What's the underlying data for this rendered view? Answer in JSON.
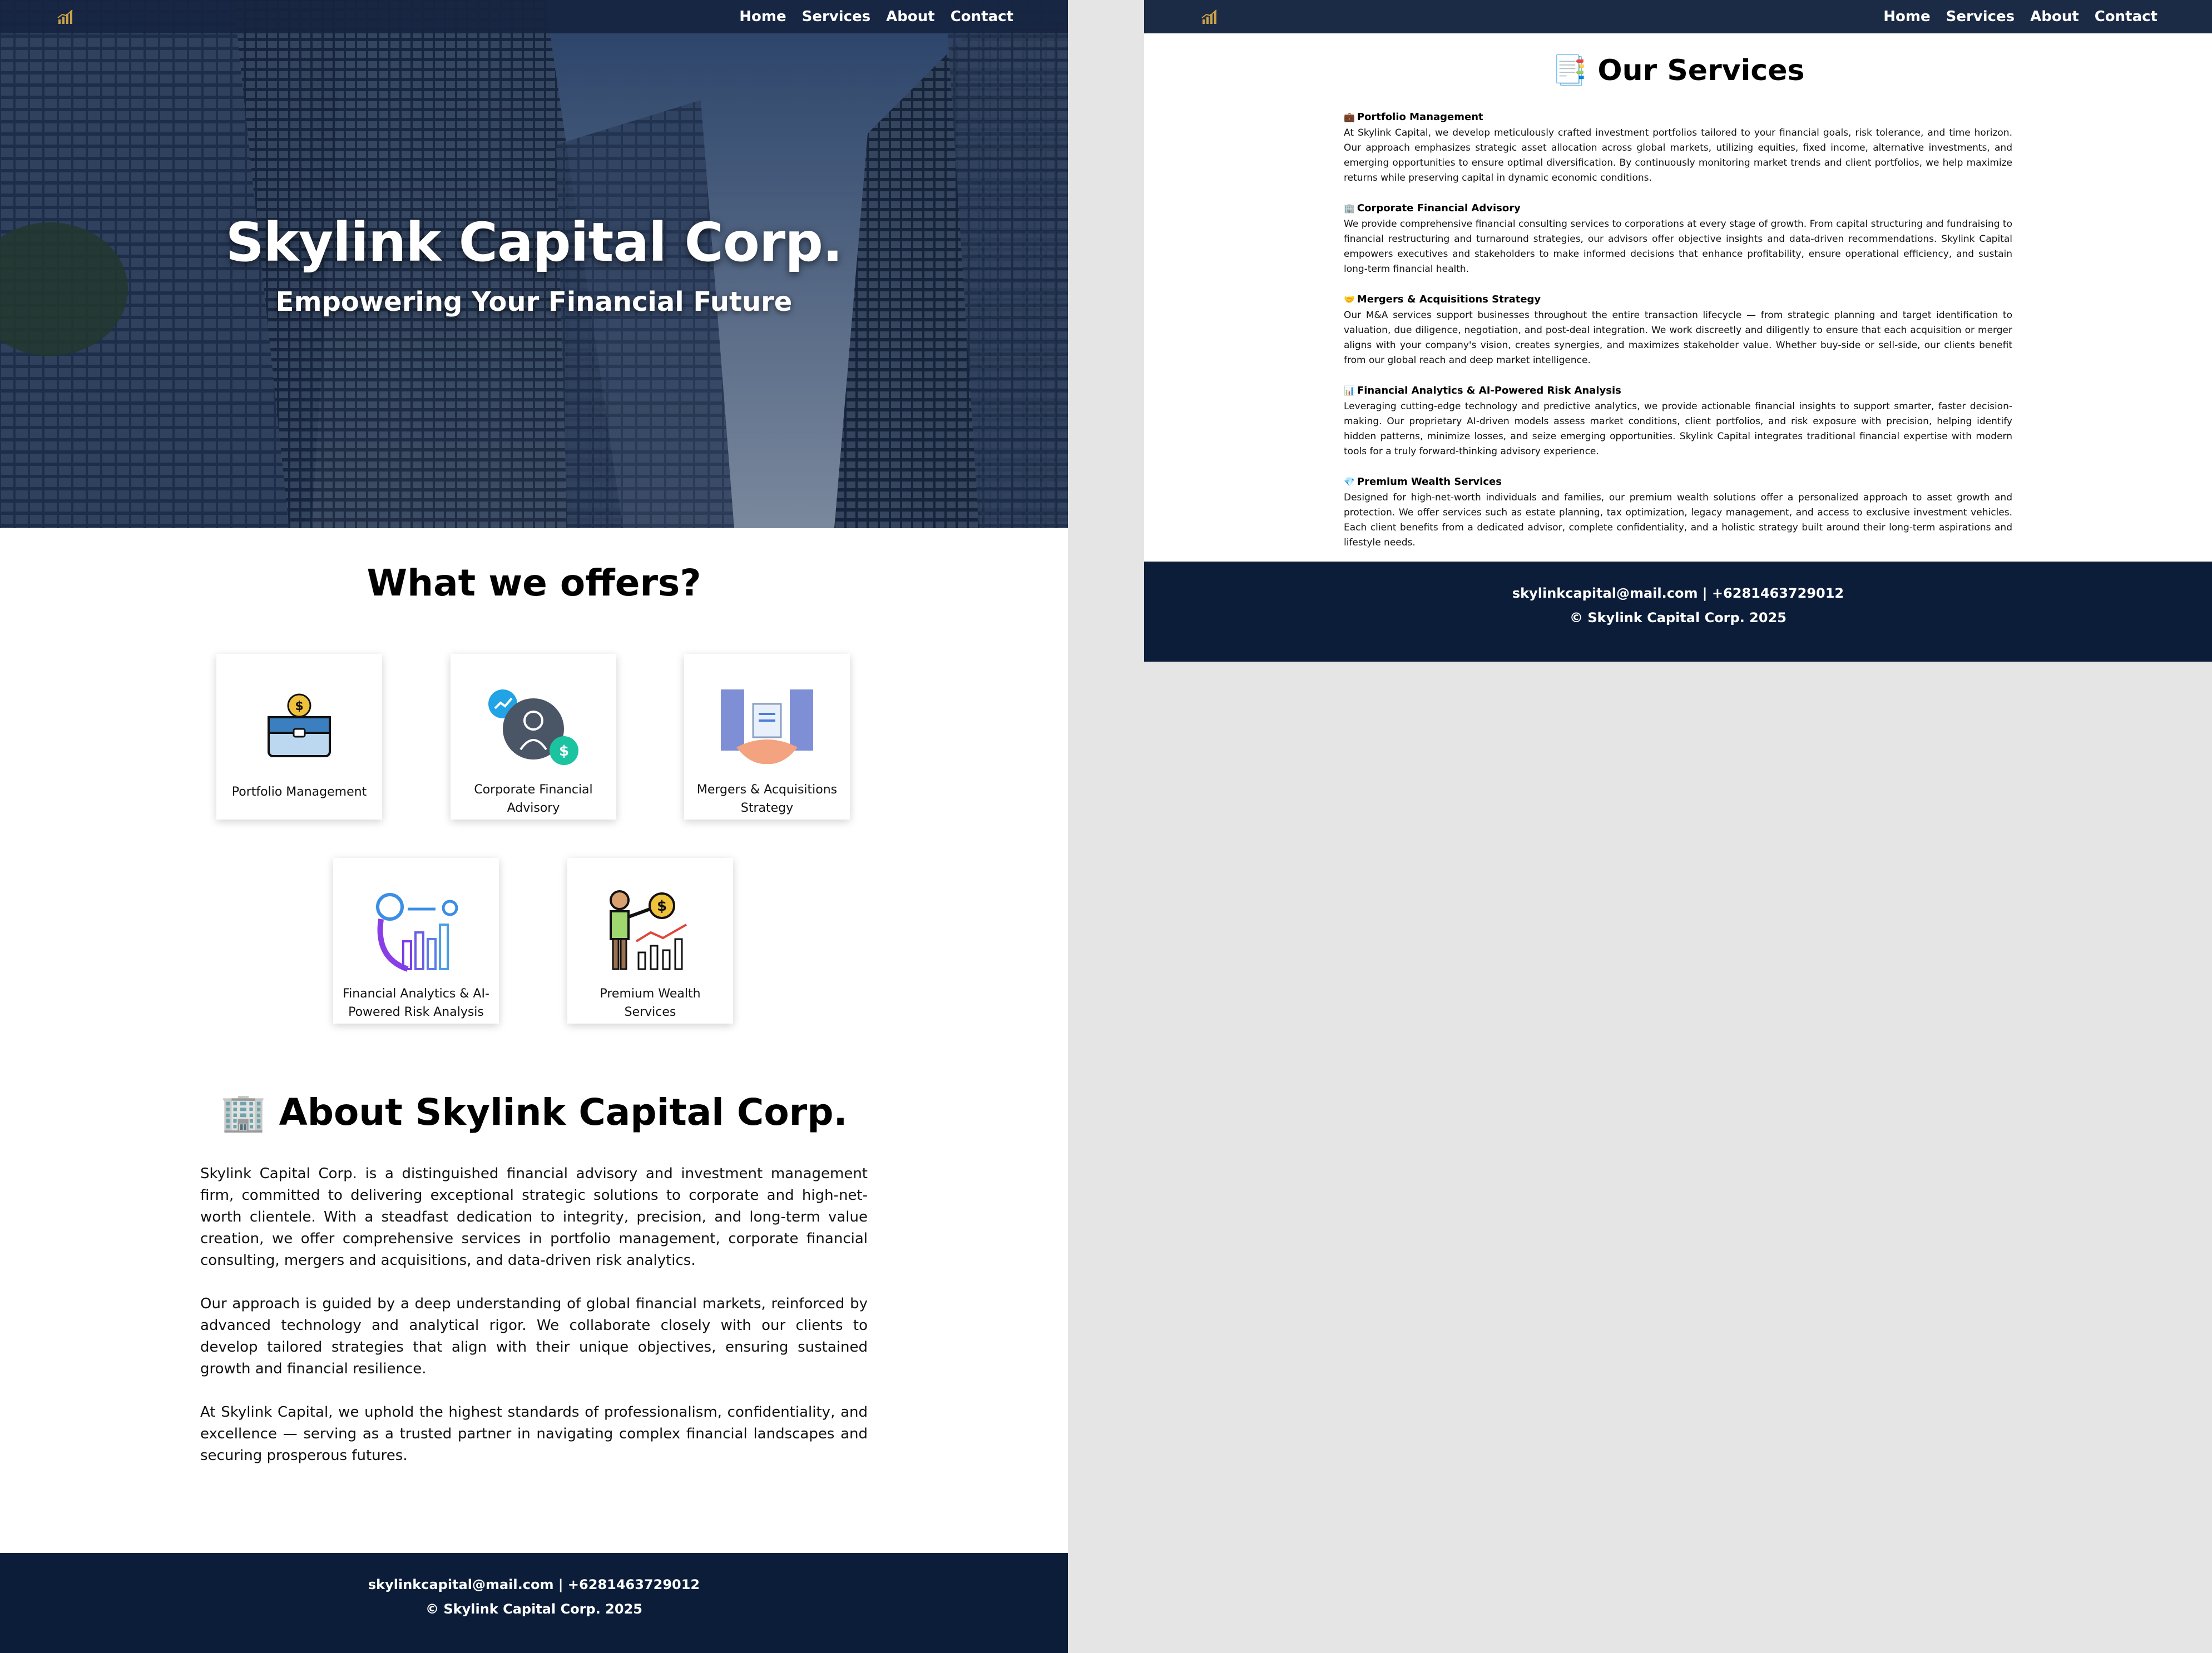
{
  "nav": {
    "items": [
      "Home",
      "Services",
      "About",
      "Contact"
    ]
  },
  "hero": {
    "title": "Skylink Capital Corp.",
    "subtitle": "Empowering Your Financial Future"
  },
  "offers": {
    "title": "What we offers?",
    "cards": [
      {
        "label": "Portfolio Management",
        "icon": "briefcase-coin-icon"
      },
      {
        "label": "Corporate Financial Advisory",
        "icon": "advisor-person-icon"
      },
      {
        "label": "Mergers & Acquisitions Strategy",
        "icon": "handshake-buildings-icon"
      },
      {
        "label": "Financial Analytics & AI-Powered Risk Analysis",
        "icon": "analytics-gear-chart-icon"
      },
      {
        "label": "Premium Wealth Services",
        "icon": "person-coin-chart-icon"
      }
    ]
  },
  "about": {
    "emoji": "🏢",
    "title": "About Skylink Capital Corp.",
    "paragraphs": [
      "Skylink Capital Corp. is a distinguished financial advisory and investment management firm, committed to delivering exceptional strategic solutions to corporate and high-net-worth clientele. With a steadfast dedication to integrity, precision, and long-term value creation, we offer comprehensive services in portfolio management, corporate financial consulting, mergers and acquisitions, and data-driven risk analytics.",
      "Our approach is guided by a deep understanding of global financial markets, reinforced by advanced technology and analytical rigor. We collaborate closely with our clients to develop tailored strategies that align with their unique objectives, ensuring sustained growth and financial resilience.",
      "At Skylink Capital, we uphold the highest standards of professionalism, confidentiality, and excellence — serving as a trusted partner in navigating complex financial landscapes and securing prosperous futures."
    ]
  },
  "footer": {
    "contact": "skylinkcapital@mail.com | +6281463729012",
    "copyright": "© Skylink Capital Corp. 2025"
  },
  "services": {
    "emoji": "📑",
    "title": "Our Services",
    "items": [
      {
        "emoji": "💼",
        "heading": "Portfolio Management",
        "body": "At Skylink Capital, we develop meticulously crafted investment portfolios tailored to your financial goals, risk tolerance, and time horizon. Our approach emphasizes strategic asset allocation across global markets, utilizing equities, fixed income, alternative investments, and emerging opportunities to ensure optimal diversification. By continuously monitoring market trends and client portfolios, we help maximize returns while preserving capital in dynamic economic conditions."
      },
      {
        "emoji": "🏢",
        "heading": "Corporate Financial Advisory",
        "body": "We provide comprehensive financial consulting services to corporations at every stage of growth. From capital structuring and fundraising to financial restructuring and turnaround strategies, our advisors offer objective insights and data-driven recommendations. Skylink Capital empowers executives and stakeholders to make informed decisions that enhance profitability, ensure operational efficiency, and sustain long-term financial health."
      },
      {
        "emoji": "🤝",
        "heading": "Mergers & Acquisitions Strategy",
        "body": "Our M&A services support businesses throughout the entire transaction lifecycle — from strategic planning and target identification to valuation, due diligence, negotiation, and post-deal integration. We work discreetly and diligently to ensure that each acquisition or merger aligns with your company's vision, creates synergies, and maximizes stakeholder value. Whether buy-side or sell-side, our clients benefit from our global reach and deep market intelligence."
      },
      {
        "emoji": "📊",
        "heading": "Financial Analytics & AI-Powered Risk Analysis",
        "body": "Leveraging cutting-edge technology and predictive analytics, we provide actionable financial insights to support smarter, faster decision-making. Our proprietary AI-driven models assess market conditions, client portfolios, and risk exposure with precision, helping identify hidden patterns, minimize losses, and seize emerging opportunities. Skylink Capital integrates traditional financial expertise with modern tools for a truly forward-thinking advisory experience."
      },
      {
        "emoji": "💎",
        "heading": "Premium Wealth Services",
        "body": "Designed for high-net-worth individuals and families, our premium wealth solutions offer a personalized approach to asset growth and protection. We offer services such as estate planning, tax optimization, legacy management, and access to exclusive investment vehicles. Each client benefits from a dedicated advisor, complete confidentiality, and a holistic strategy built around their long-term aspirations and lifestyle needs."
      }
    ]
  },
  "colors": {
    "navbar": "#1b2a45",
    "footer": "#0b1d39",
    "logo_gold": "#c9a24a",
    "background": "#e5e5e5"
  }
}
